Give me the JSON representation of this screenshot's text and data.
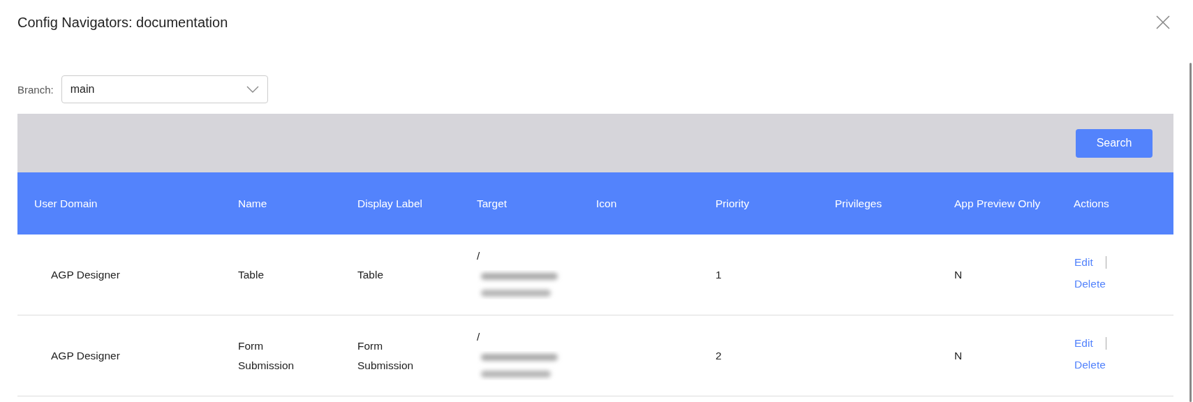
{
  "dialog": {
    "title": "Config Navigators: documentation"
  },
  "branch": {
    "label": "Branch:",
    "value": "main"
  },
  "search_button": "Search",
  "table": {
    "columns": [
      "User Domain",
      "Name",
      "Display Label",
      "Target",
      "Icon",
      "Priority",
      "Privileges",
      "App Preview Only",
      "Actions"
    ],
    "rows": [
      {
        "user_domain": "AGP Designer",
        "name": "Table",
        "display_label": "Table",
        "target": "/",
        "target_blurred": true,
        "icon": "",
        "priority": "1",
        "privileges": "",
        "app_preview_only": "N",
        "actions": [
          "Edit",
          "Delete"
        ]
      },
      {
        "user_domain": "AGP Designer",
        "name": "Form Submission",
        "display_label": "Form Submission",
        "target": "/",
        "target_blurred": true,
        "icon": "",
        "priority": "2",
        "privileges": "",
        "app_preview_only": "N",
        "actions": [
          "Edit",
          "Delete"
        ]
      }
    ]
  }
}
